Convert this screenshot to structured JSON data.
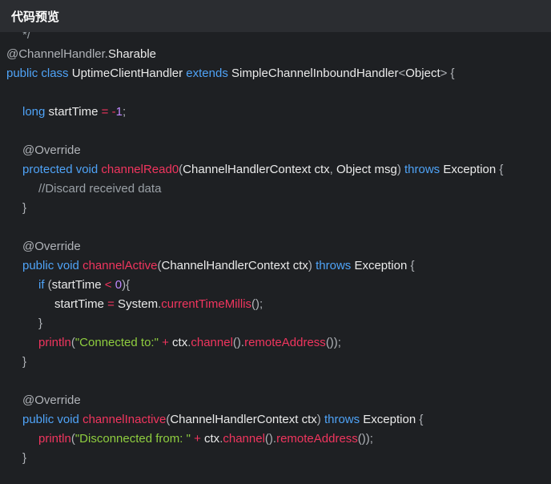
{
  "header": {
    "title": "代码预览"
  },
  "code": {
    "lines": [
      {
        "indent": 1,
        "tokens": [
          {
            "t": "*/",
            "c": "cmt"
          }
        ],
        "partial": true
      },
      {
        "indent": 0,
        "tokens": [
          {
            "t": "@ChannelHandler.",
            "c": "ann"
          },
          {
            "t": "Sharable",
            "c": "def"
          }
        ]
      },
      {
        "indent": 0,
        "tokens": [
          {
            "t": "public",
            "c": "kw"
          },
          {
            "t": " ",
            "c": "def"
          },
          {
            "t": "class",
            "c": "kw"
          },
          {
            "t": " UptimeClientHandler ",
            "c": "def"
          },
          {
            "t": "extends",
            "c": "kw"
          },
          {
            "t": " SimpleChannelInboundHandler",
            "c": "def"
          },
          {
            "t": "<",
            "c": "punc"
          },
          {
            "t": "Object",
            "c": "def"
          },
          {
            "t": ">",
            "c": "punc"
          },
          {
            "t": " {",
            "c": "punc"
          }
        ]
      },
      {
        "indent": 0,
        "tokens": []
      },
      {
        "indent": 1,
        "tokens": [
          {
            "t": "long",
            "c": "kw"
          },
          {
            "t": " startTime ",
            "c": "def"
          },
          {
            "t": "=",
            "c": "op"
          },
          {
            "t": " ",
            "c": "def"
          },
          {
            "t": "-",
            "c": "op"
          },
          {
            "t": "1",
            "c": "num"
          },
          {
            "t": ";",
            "c": "punc"
          }
        ]
      },
      {
        "indent": 0,
        "tokens": []
      },
      {
        "indent": 1,
        "tokens": [
          {
            "t": "@Override",
            "c": "ann"
          }
        ]
      },
      {
        "indent": 1,
        "tokens": [
          {
            "t": "protected",
            "c": "kw"
          },
          {
            "t": " ",
            "c": "def"
          },
          {
            "t": "void",
            "c": "kw"
          },
          {
            "t": " ",
            "c": "def"
          },
          {
            "t": "channelRead0",
            "c": "fn"
          },
          {
            "t": "(",
            "c": "punc"
          },
          {
            "t": "ChannelHandlerContext ctx",
            "c": "def"
          },
          {
            "t": ",",
            "c": "punc"
          },
          {
            "t": " Object msg",
            "c": "def"
          },
          {
            "t": ")",
            "c": "punc"
          },
          {
            "t": " ",
            "c": "def"
          },
          {
            "t": "throws",
            "c": "kw"
          },
          {
            "t": " Exception ",
            "c": "def"
          },
          {
            "t": "{",
            "c": "punc"
          }
        ]
      },
      {
        "indent": 2,
        "tokens": [
          {
            "t": "//Discard received data",
            "c": "cmt"
          }
        ]
      },
      {
        "indent": 1,
        "tokens": [
          {
            "t": "}",
            "c": "punc"
          }
        ]
      },
      {
        "indent": 0,
        "tokens": []
      },
      {
        "indent": 1,
        "tokens": [
          {
            "t": "@Override",
            "c": "ann"
          }
        ]
      },
      {
        "indent": 1,
        "tokens": [
          {
            "t": "public",
            "c": "kw"
          },
          {
            "t": " ",
            "c": "def"
          },
          {
            "t": "void",
            "c": "kw"
          },
          {
            "t": " ",
            "c": "def"
          },
          {
            "t": "channelActive",
            "c": "fn"
          },
          {
            "t": "(",
            "c": "punc"
          },
          {
            "t": "ChannelHandlerContext ctx",
            "c": "def"
          },
          {
            "t": ")",
            "c": "punc"
          },
          {
            "t": " ",
            "c": "def"
          },
          {
            "t": "throws",
            "c": "kw"
          },
          {
            "t": " Exception ",
            "c": "def"
          },
          {
            "t": "{",
            "c": "punc"
          }
        ]
      },
      {
        "indent": 2,
        "tokens": [
          {
            "t": "if",
            "c": "kw"
          },
          {
            "t": " (",
            "c": "punc"
          },
          {
            "t": "startTime ",
            "c": "def"
          },
          {
            "t": "<",
            "c": "op"
          },
          {
            "t": " ",
            "c": "def"
          },
          {
            "t": "0",
            "c": "num"
          },
          {
            "t": "){",
            "c": "punc"
          }
        ]
      },
      {
        "indent": 3,
        "tokens": [
          {
            "t": "startTime ",
            "c": "def"
          },
          {
            "t": "=",
            "c": "op"
          },
          {
            "t": " System",
            "c": "def"
          },
          {
            "t": ".",
            "c": "punc"
          },
          {
            "t": "currentTimeMillis",
            "c": "fn"
          },
          {
            "t": "();",
            "c": "punc"
          }
        ]
      },
      {
        "indent": 2,
        "tokens": [
          {
            "t": "}",
            "c": "punc"
          }
        ]
      },
      {
        "indent": 2,
        "tokens": [
          {
            "t": "println",
            "c": "fn"
          },
          {
            "t": "(",
            "c": "punc"
          },
          {
            "t": "\"Connected to:\"",
            "c": "str"
          },
          {
            "t": " ",
            "c": "def"
          },
          {
            "t": "+",
            "c": "op"
          },
          {
            "t": " ctx",
            "c": "def"
          },
          {
            "t": ".",
            "c": "punc"
          },
          {
            "t": "channel",
            "c": "fn"
          },
          {
            "t": "().",
            "c": "punc"
          },
          {
            "t": "remoteAddress",
            "c": "fn"
          },
          {
            "t": "());",
            "c": "punc"
          }
        ]
      },
      {
        "indent": 1,
        "tokens": [
          {
            "t": "}",
            "c": "punc"
          }
        ]
      },
      {
        "indent": 0,
        "tokens": []
      },
      {
        "indent": 1,
        "tokens": [
          {
            "t": "@Override",
            "c": "ann"
          }
        ]
      },
      {
        "indent": 1,
        "tokens": [
          {
            "t": "public",
            "c": "kw"
          },
          {
            "t": " ",
            "c": "def"
          },
          {
            "t": "void",
            "c": "kw"
          },
          {
            "t": " ",
            "c": "def"
          },
          {
            "t": "channelInactive",
            "c": "fn"
          },
          {
            "t": "(",
            "c": "punc"
          },
          {
            "t": "ChannelHandlerContext ctx",
            "c": "def"
          },
          {
            "t": ")",
            "c": "punc"
          },
          {
            "t": " ",
            "c": "def"
          },
          {
            "t": "throws",
            "c": "kw"
          },
          {
            "t": " Exception ",
            "c": "def"
          },
          {
            "t": "{",
            "c": "punc"
          }
        ]
      },
      {
        "indent": 2,
        "tokens": [
          {
            "t": "println",
            "c": "fn"
          },
          {
            "t": "(",
            "c": "punc"
          },
          {
            "t": "\"Disconnected from: \"",
            "c": "str"
          },
          {
            "t": " ",
            "c": "def"
          },
          {
            "t": "+",
            "c": "op"
          },
          {
            "t": " ctx",
            "c": "def"
          },
          {
            "t": ".",
            "c": "punc"
          },
          {
            "t": "channel",
            "c": "fn"
          },
          {
            "t": "().",
            "c": "punc"
          },
          {
            "t": "remoteAddress",
            "c": "fn"
          },
          {
            "t": "());",
            "c": "punc"
          }
        ]
      },
      {
        "indent": 1,
        "tokens": [
          {
            "t": "}",
            "c": "punc"
          }
        ]
      }
    ]
  }
}
